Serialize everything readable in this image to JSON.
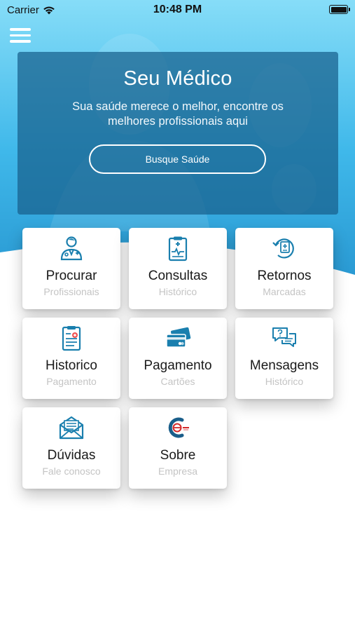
{
  "status_bar": {
    "carrier": "Carrier",
    "time": "10:48 PM"
  },
  "banner": {
    "title": "Seu Médico",
    "subtitle": "Sua saúde merece o melhor, encontre os melhores profissionais aqui",
    "button_label": "Busque Saúde"
  },
  "cards": [
    {
      "title": "Procurar",
      "subtitle": "Profissionais",
      "icon": "doctor-icon"
    },
    {
      "title": "Consultas",
      "subtitle": "Histórico",
      "icon": "clipboard-heartbeat-icon"
    },
    {
      "title": "Retornos",
      "subtitle": "Marcadas",
      "icon": "return-history-icon"
    },
    {
      "title": "Historico",
      "subtitle": "Pagamento",
      "icon": "medical-record-icon"
    },
    {
      "title": "Pagamento",
      "subtitle": "Cartões",
      "icon": "credit-cards-icon"
    },
    {
      "title": "Mensagens",
      "subtitle": "Histórico",
      "icon": "chat-bubbles-icon"
    },
    {
      "title": "Dúvidas",
      "subtitle": "Fale conosco",
      "icon": "envelope-icon"
    },
    {
      "title": "Sobre",
      "subtitle": "Empresa",
      "icon": "company-logo-icon"
    }
  ],
  "colors": {
    "accent": "#1a7fae",
    "hero_light": "#5ed0f6",
    "hero_dark": "#1e90c8"
  }
}
